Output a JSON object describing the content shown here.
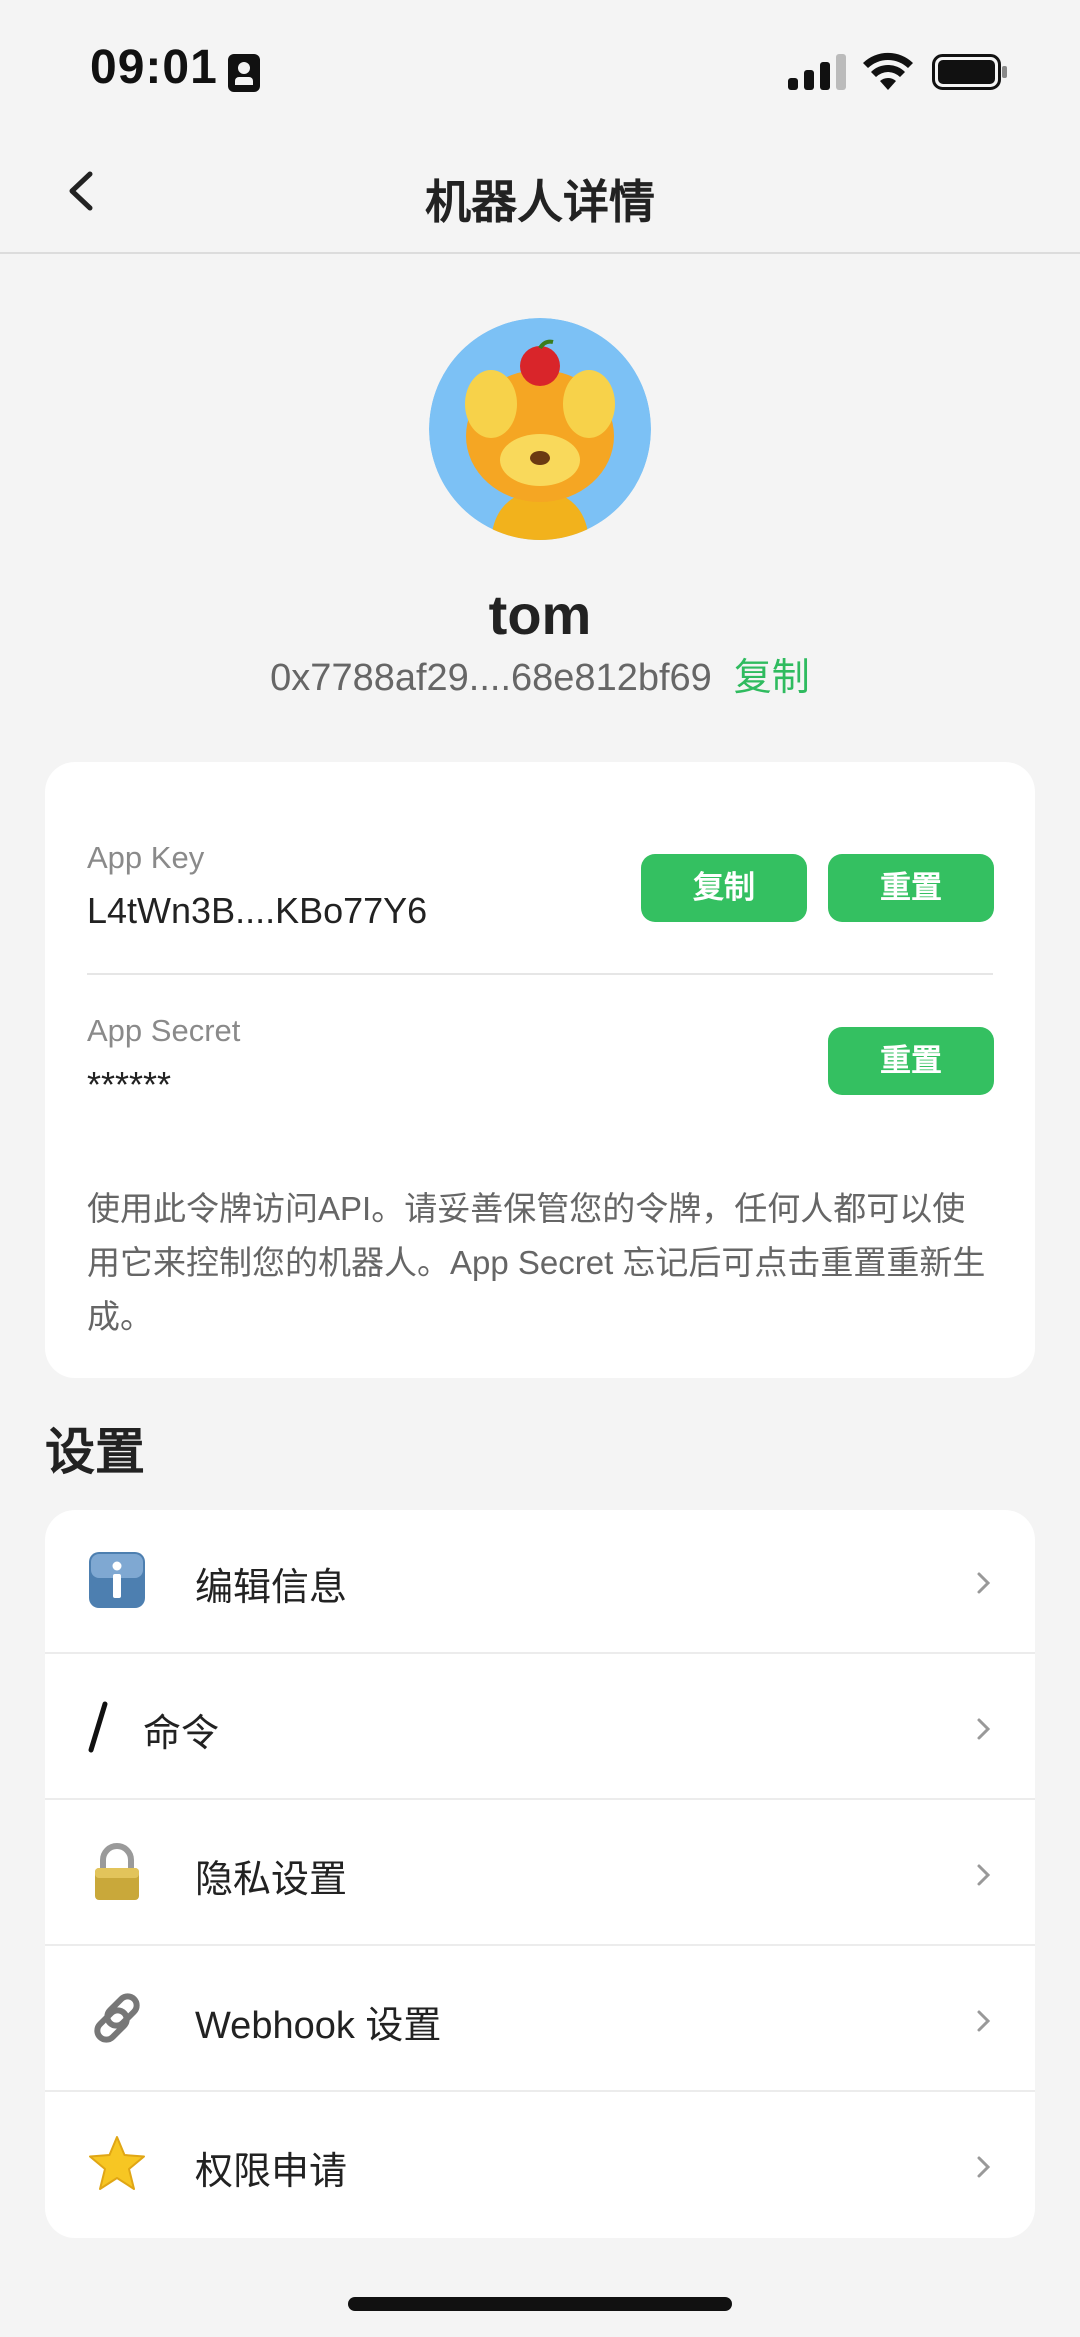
{
  "status_bar": {
    "time": "09:01"
  },
  "nav": {
    "title": "机器人详情"
  },
  "profile": {
    "name": "tom",
    "address": "0x7788af29....68e812bf69",
    "copy_label": "复制"
  },
  "credentials": {
    "app_key": {
      "label": "App Key",
      "value": "L4tWn3B....KBo77Y6",
      "copy_button": "复制",
      "reset_button": "重置"
    },
    "app_secret": {
      "label": "App Secret",
      "value": "******",
      "reset_button": "重置"
    },
    "note": "使用此令牌访问API。请妥善保管您的令牌，任何人都可以使用它来控制您的机器人。App Secret 忘记后可点击重置重新生成。"
  },
  "settings": {
    "title": "设置",
    "items": [
      {
        "label": "编辑信息",
        "icon": "info-icon"
      },
      {
        "label": "命令",
        "icon": "slash-icon"
      },
      {
        "label": "隐私设置",
        "icon": "lock-icon"
      },
      {
        "label": "Webhook 设置",
        "icon": "link-icon"
      },
      {
        "label": "权限申请",
        "icon": "star-icon"
      }
    ]
  },
  "colors": {
    "accent": "#34c061",
    "link": "#2fbb5f",
    "background": "#f4f4f4",
    "card": "#ffffff",
    "avatar_bg": "#7cc1f5"
  }
}
